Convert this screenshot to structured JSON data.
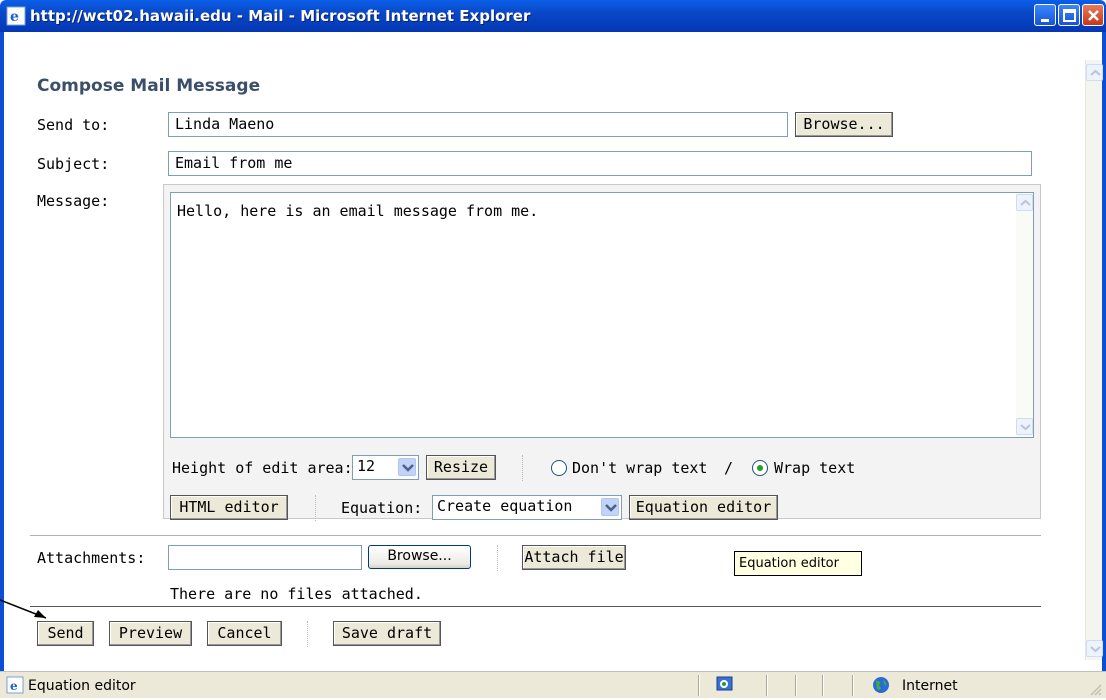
{
  "window": {
    "title": "http://wct02.hawaii.edu - Mail - Microsoft Internet Explorer",
    "controls": [
      "minimize-icon",
      "maximize-icon",
      "close-icon"
    ]
  },
  "compose": {
    "heading": "Compose Mail Message",
    "send_to_label": "Send to:",
    "send_to_value": "Linda Maeno",
    "browse_label": "Browse...",
    "subject_label": "Subject:",
    "subject_value": "Email from me",
    "message_label": "Message:",
    "message_value": "Hello, here is an email message from me."
  },
  "editor_options": {
    "height_label": "Height of edit area:",
    "height_value": "12",
    "resize_label": "Resize",
    "dont_wrap_label": "Don't wrap text",
    "slash": "/",
    "wrap_label": "Wrap text",
    "wrap_selected": true,
    "html_editor_label": "HTML editor",
    "equation_label": "Equation:",
    "equation_value": "Create equation",
    "equation_editor_label": "Equation editor"
  },
  "attachments": {
    "label": "Attachments:",
    "browse_label": "Browse...",
    "attach_label": "Attach file",
    "none_text": "There are no files attached."
  },
  "tooltip": "Equation editor",
  "actions": {
    "send": "Send",
    "preview": "Preview",
    "cancel": "Cancel",
    "save_draft": "Save draft"
  },
  "statusbar": {
    "text": "Equation editor",
    "zone": "Internet"
  }
}
